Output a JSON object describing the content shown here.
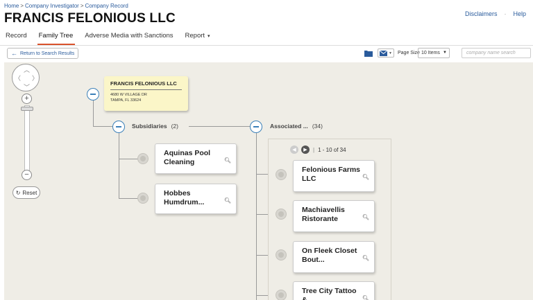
{
  "breadcrumb": [
    "Home",
    "Company Investigator",
    "Company Record"
  ],
  "breadcrumb_sep": ">",
  "title": "FRANCIS FELONIOUS LLC",
  "top_links": {
    "disclaimers": "Disclaimers",
    "dot": "·",
    "help": "Help"
  },
  "tabs": [
    {
      "label": "Record"
    },
    {
      "label": "Family Tree",
      "active": true
    },
    {
      "label": "Adverse Media with Sanctions"
    },
    {
      "label": "Report",
      "caret": "▾"
    }
  ],
  "toolbar": {
    "return_label": "Return to Search Results",
    "return_icon": "←",
    "page_size_label": "Page Size",
    "page_size_value": "10 Items",
    "page_size_caret": "▼",
    "search_placeholder": "company name search"
  },
  "controls": {
    "zoom_in": "+",
    "zoom_out": "−",
    "reset_label": "Reset",
    "reset_icon": "↻"
  },
  "root": {
    "name": "FRANCIS FELONIOUS LLC",
    "address_line1": "4680 W VILLAGE DR",
    "address_line2": "TAMPA, FL 33624"
  },
  "subsidiaries": {
    "label": "Subsidiaries",
    "count": "(2)",
    "items": [
      "Aquinas Pool Cleaning",
      "Hobbes Humdrum..."
    ]
  },
  "associated": {
    "label": "Associated ...",
    "count": "(34)",
    "pager": "1 - 10 of 34",
    "pager_sep": "|",
    "items": [
      "Felonious Farms LLC",
      "Machiavellis Ristorante",
      "On Fleek Closet Bout...",
      "Tree City Tattoo &..."
    ]
  },
  "colors": {
    "accent": "#3a7fb8",
    "tab_underline": "#d9522b",
    "root_card": "#fbf6c8",
    "canvas": "#efede6"
  }
}
